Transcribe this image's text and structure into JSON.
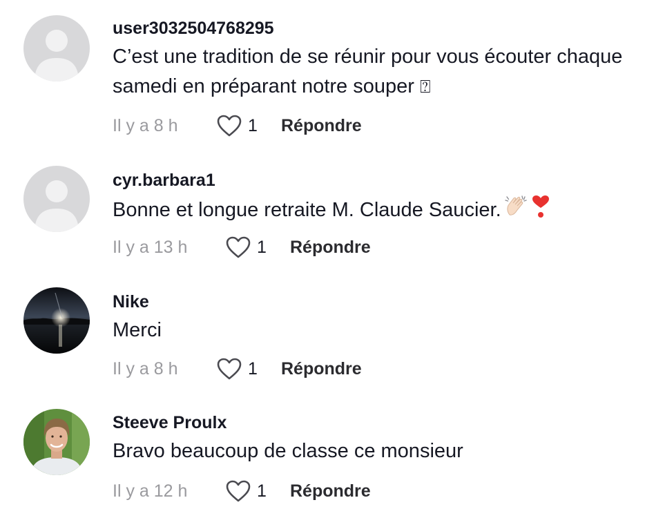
{
  "comments": [
    {
      "username": "user3032504768295",
      "text": "C’est une tradition de se réunir pour vous écouter chaque samedi en préparant notre souper",
      "trailing_glyph": "⍰",
      "time": "Il y a 8 h",
      "likes": "1",
      "reply_label": "Répondre",
      "avatar": "default-avatar"
    },
    {
      "username": "cyr.barbara1",
      "text": "Bonne et longue retraite M. Claude Saucier.",
      "emojis": [
        "clapping-hands-emoji",
        "heart-exclamation-emoji"
      ],
      "time": "Il y a 13 h",
      "likes": "1",
      "reply_label": "Répondre",
      "avatar": "default-avatar"
    },
    {
      "username": "Nike",
      "text": "Merci",
      "time": "Il y a 8 h",
      "likes": "1",
      "reply_label": "Répondre",
      "avatar": "lake-sunset-photo"
    },
    {
      "username": "Steeve Proulx",
      "text": "Bravo beaucoup de classe ce monsieur",
      "time": "Il y a 12 h",
      "likes": "1",
      "reply_label": "Répondre",
      "avatar": "man-portrait-photo"
    }
  ],
  "colors": {
    "primary_text": "#161823",
    "secondary_text": "#9a9a9e",
    "heart_outline": "#4a4a50",
    "default_avatar_bg": "#d8d8da"
  }
}
